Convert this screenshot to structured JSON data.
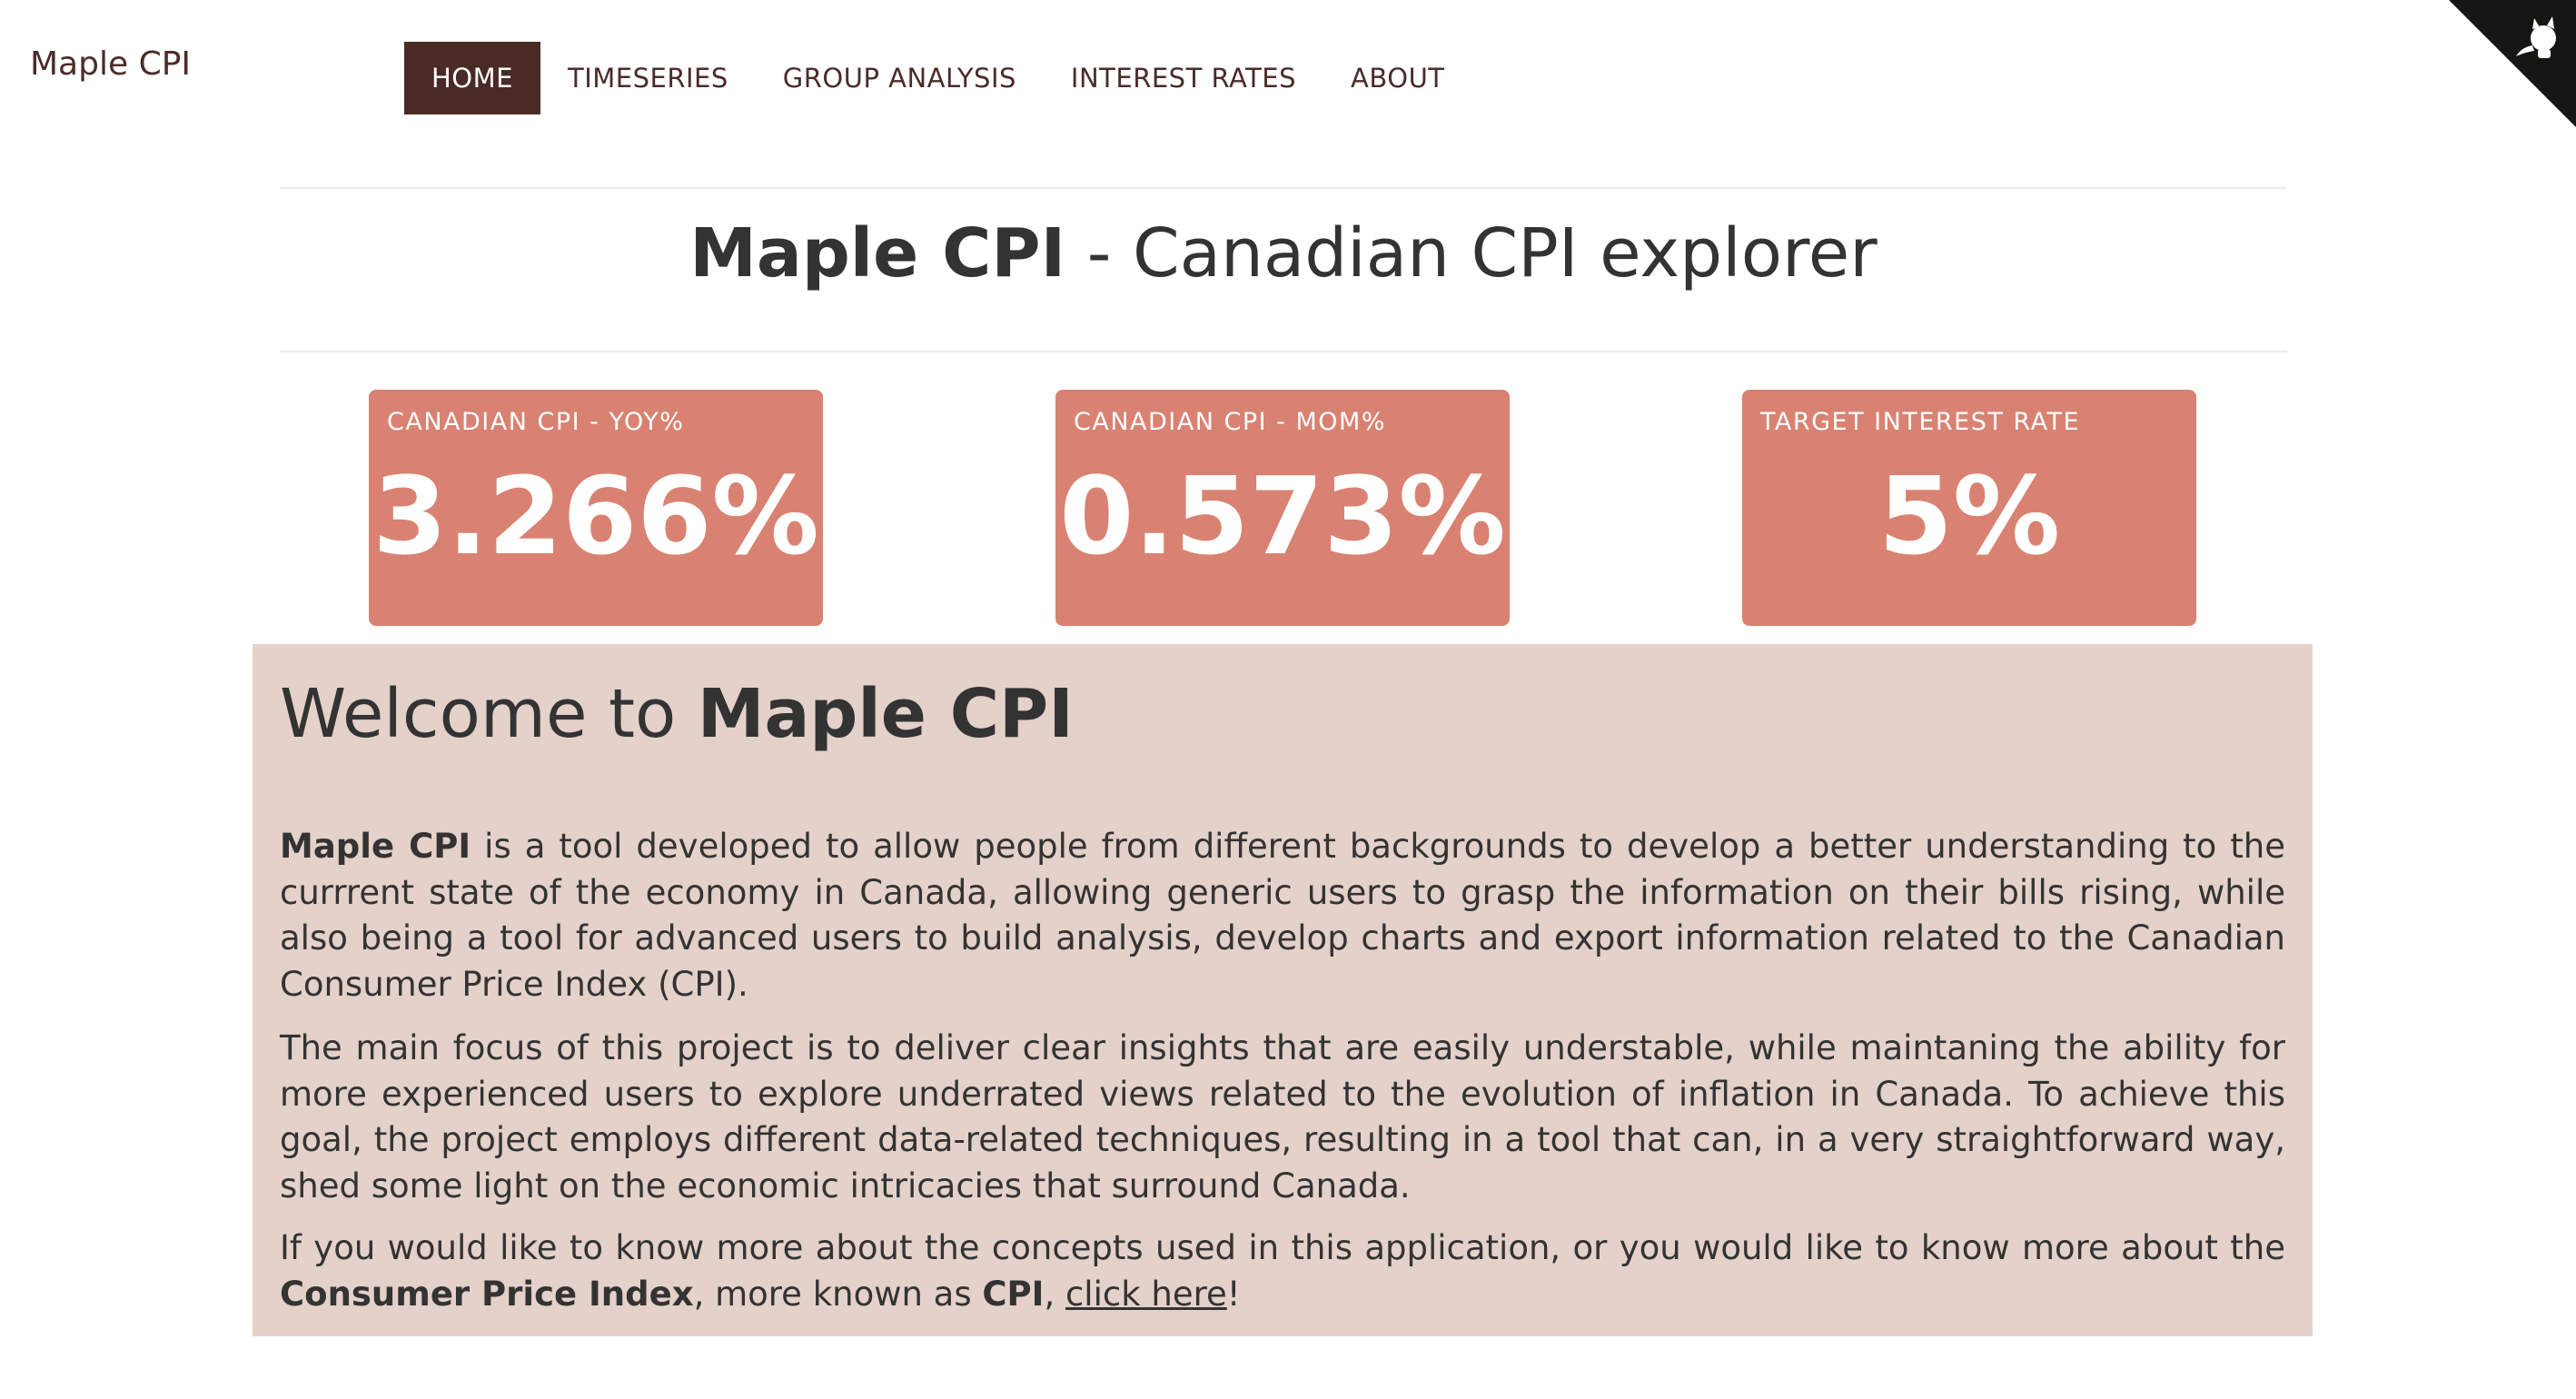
{
  "brand": "Maple CPI",
  "nav": {
    "items": [
      {
        "label": "HOME",
        "active": true
      },
      {
        "label": "TIMESERIES",
        "active": false
      },
      {
        "label": "GROUP ANALYSIS",
        "active": false
      },
      {
        "label": "INTEREST RATES",
        "active": false
      },
      {
        "label": "ABOUT",
        "active": false
      }
    ]
  },
  "github_corner": {
    "icon": "octocat-icon"
  },
  "header": {
    "title_bold": "Maple CPI",
    "title_rest": " - Canadian CPI explorer"
  },
  "cards": [
    {
      "label": "CANADIAN CPI - YOY%",
      "value": "3.266%"
    },
    {
      "label": "CANADIAN CPI - MOM%",
      "value": "0.573%"
    },
    {
      "label": "TARGET INTEREST RATE",
      "value": "5%"
    }
  ],
  "welcome": {
    "title_prefix": "Welcome to ",
    "title_bold": "Maple CPI",
    "p1_bold": "Maple CPI",
    "p1_text": " is a tool developed to allow people from different backgrounds to develop a better understanding to the currrent state of the economy in Canada, allowing generic users to grasp the information on their bills rising, while also being a tool for advanced users to build analysis, develop charts and export information related to the Canadian Consumer Price Index (CPI).",
    "p2_text": "The main focus of this project is to deliver clear insights that are easily understable, while maintaning the ability for more experienced users to explore underrated views related to the evolution of inflation in Canada. To achieve this goal, the project employs different data-related techniques, resulting in a tool that can, in a very straightforward way, shed some light on the economic intricacies that surround Canada.",
    "p3_text_a": "If you would like to know more about the concepts used in this application, or you would like to know more about the ",
    "p3_bold_a": "Consumer Price Index",
    "p3_text_b": ", more known as ",
    "p3_bold_b": "CPI",
    "p3_text_c": ", ",
    "p3_link": "click here",
    "p3_text_d": "!"
  },
  "colors": {
    "brand": "#4a2c2a",
    "nav_active_bg": "#4a2a26",
    "card_bg": "#d98272",
    "panel_bg": "#e4d1c9"
  }
}
